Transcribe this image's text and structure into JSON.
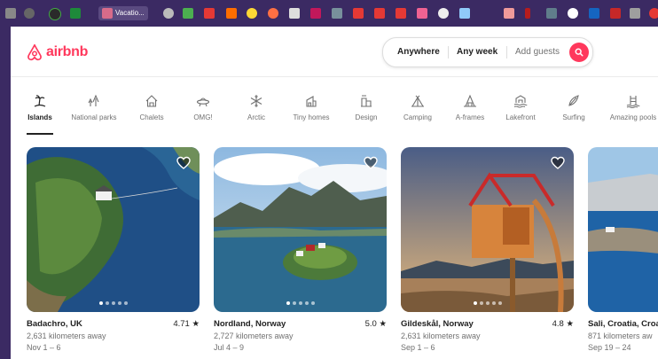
{
  "browser": {
    "active_tab_label": "Vacatio..."
  },
  "header": {
    "brand": "airbnb",
    "search": {
      "anywhere": "Anywhere",
      "any_week": "Any week",
      "guests_placeholder": "Add guests"
    }
  },
  "categories": [
    {
      "label": "Islands",
      "icon": "island-icon",
      "active": true
    },
    {
      "label": "National parks",
      "icon": "national-park-icon",
      "active": false
    },
    {
      "label": "Chalets",
      "icon": "chalet-icon",
      "active": false
    },
    {
      "label": "OMG!",
      "icon": "ufo-icon",
      "active": false
    },
    {
      "label": "Arctic",
      "icon": "snowflake-icon",
      "active": false
    },
    {
      "label": "Tiny homes",
      "icon": "tiny-home-icon",
      "active": false
    },
    {
      "label": "Design",
      "icon": "design-icon",
      "active": false
    },
    {
      "label": "Camping",
      "icon": "camping-icon",
      "active": false
    },
    {
      "label": "A-frames",
      "icon": "a-frame-icon",
      "active": false
    },
    {
      "label": "Lakefront",
      "icon": "lakefront-icon",
      "active": false
    },
    {
      "label": "Surfing",
      "icon": "surfboard-icon",
      "active": false
    },
    {
      "label": "Amazing pools",
      "icon": "pool-icon",
      "active": false
    }
  ],
  "listings": [
    {
      "title": "Badachro, UK",
      "rating": "4.71 ★",
      "distance": "2,631 kilometers away",
      "dates": "Nov 1 – 6"
    },
    {
      "title": "Nordland, Norway",
      "rating": "5.0 ★",
      "distance": "2,727 kilometers away",
      "dates": "Jul 4 – 9"
    },
    {
      "title": "Gildeskål, Norway",
      "rating": "4.8 ★",
      "distance": "2,631 kilometers away",
      "dates": "Sep 1 – 6"
    },
    {
      "title": "Sali, Croatia, Croa",
      "rating": "",
      "distance": "871 kilometers aw",
      "dates": "Sep 19 – 24"
    }
  ],
  "colors": {
    "brand": "#ff385c",
    "text": "#222222",
    "muted": "#717171",
    "chrome": "#3b2a63"
  }
}
